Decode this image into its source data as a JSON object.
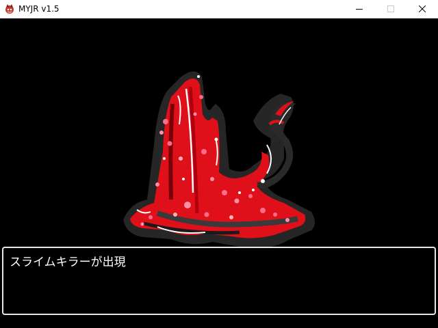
{
  "window": {
    "title": "MYJR v1.5",
    "controls": {
      "minimize_icon": "minimize-icon",
      "maximize_icon": "maximize-icon",
      "close_icon": "close-icon"
    }
  },
  "battle": {
    "enemy_icon": "slime-killer-monster",
    "message": "スライムキラーが出現"
  },
  "colors": {
    "titlebar_bg": "#ffffff",
    "game_bg": "#000000",
    "message_border": "#e8e8e8",
    "monster_red": "#e0101a",
    "monster_dark": "#2a2a2a"
  }
}
